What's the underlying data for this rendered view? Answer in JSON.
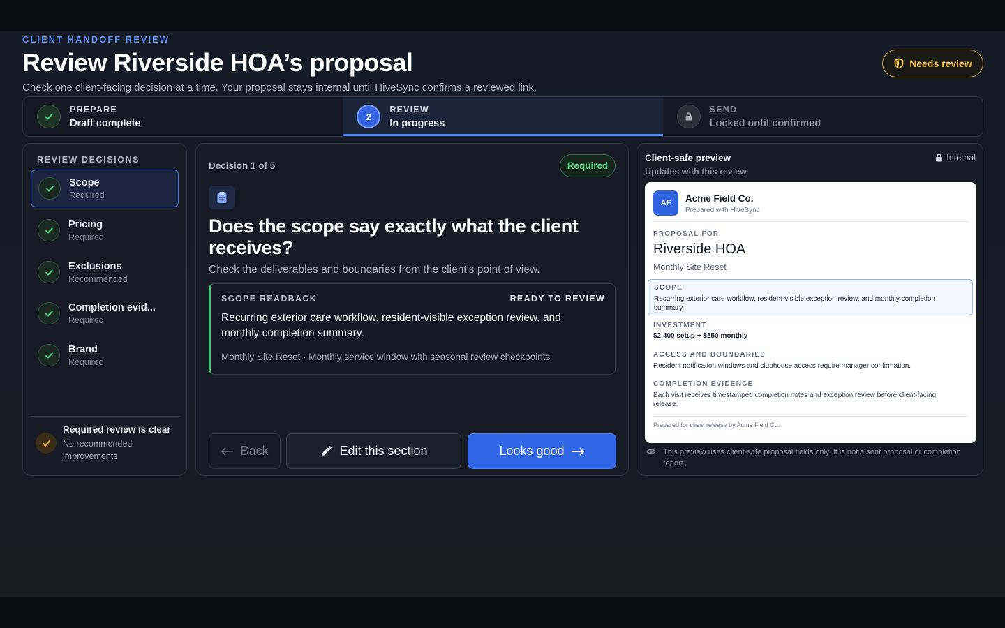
{
  "header": {
    "eyebrow": "CLIENT HANDOFF REVIEW",
    "title": "Review Riverside HOA’s proposal",
    "subtitle": "Check one client-facing decision at a time. Your proposal stays internal until HiveSync confirms a reviewed link.",
    "status_badge": "Needs review"
  },
  "stepper": [
    {
      "kicker": "PREPARE",
      "label": "Draft complete",
      "state": "done"
    },
    {
      "kicker": "REVIEW",
      "label": "In progress",
      "state": "current",
      "number": "2"
    },
    {
      "kicker": "SEND",
      "label": "Locked until confirmed",
      "state": "locked"
    }
  ],
  "sidebar": {
    "title": "REVIEW DECISIONS",
    "items": [
      {
        "name": "Scope",
        "status": "Required"
      },
      {
        "name": "Pricing",
        "status": "Required"
      },
      {
        "name": "Exclusions",
        "status": "Recommended"
      },
      {
        "name": "Completion evid...",
        "status": "Required"
      },
      {
        "name": "Brand",
        "status": "Required"
      }
    ],
    "footer_title": "Required review is clear",
    "footer_text": "No recommended improvements"
  },
  "decision": {
    "counter": "Decision 1 of 5",
    "badge": "Required",
    "question": "Does the scope say exactly what the client receives?",
    "subtitle": "Check the deliverables and boundaries from the client’s point of view.",
    "readback_kicker": "SCOPE READBACK",
    "readback_status": "READY TO REVIEW",
    "readback_body": "Recurring exterior care workflow, resident-visible exception review, and monthly completion summary.",
    "readback_meta": "Monthly Site Reset · Monthly service window with seasonal review checkpoints",
    "back_label": "Back",
    "edit_label": "Edit this section",
    "good_label": "Looks good"
  },
  "preview": {
    "title": "Client-safe preview",
    "subtitle": "Updates with this review",
    "visibility": "Internal",
    "logo_initials": "AF",
    "company": "Acme Field Co.",
    "prepared": "Prepared with HiveSync",
    "proposal_for_kicker": "PROPOSAL FOR",
    "client": "Riverside HOA",
    "plan": "Monthly Site Reset",
    "scope_kicker": "SCOPE",
    "scope_text": "Recurring exterior care workflow, resident-visible exception review, and monthly completion summary.",
    "investment_kicker": "INVESTMENT",
    "investment_text": "$2,400 setup + $850 monthly",
    "access_kicker": "ACCESS AND BOUNDARIES",
    "access_text": "Resident notification windows and clubhouse access require manager confirmation.",
    "evidence_kicker": "COMPLETION EVIDENCE",
    "evidence_text": "Each visit receives timestamped completion notes and exception review before client-facing release.",
    "doc_footer": "Prepared for client release by Acme Field Co.",
    "note": "This preview uses client-safe proposal fields only. It is not a sent proposal or completion report."
  },
  "colors": {
    "accent": "#3166e6",
    "success": "#43c26a",
    "warning": "#f3c451",
    "background": "#141a26"
  }
}
